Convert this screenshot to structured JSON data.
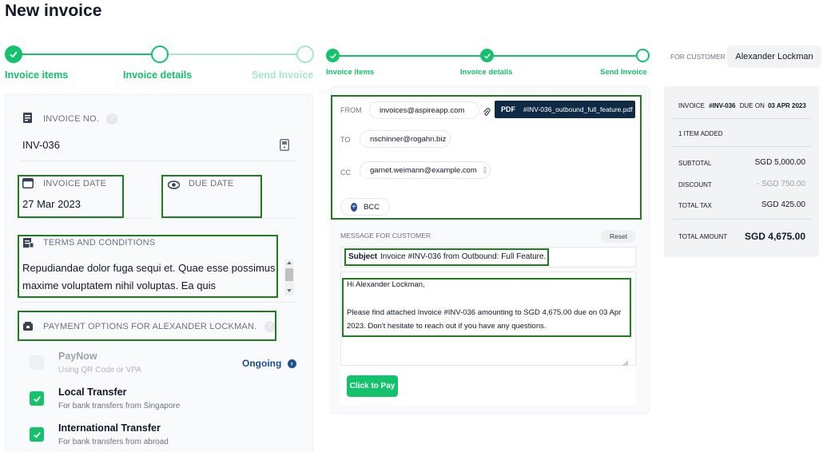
{
  "page": {
    "title": "New invoice"
  },
  "stepper_main": {
    "steps": [
      {
        "label": "Invoice items",
        "state": "done"
      },
      {
        "label": "Invoice details",
        "state": "current"
      },
      {
        "label": "Send Invoice",
        "state": "upcoming"
      }
    ]
  },
  "stepper_send": {
    "steps": [
      {
        "label": "Invoice items",
        "state": "done"
      },
      {
        "label": "Invoice details",
        "state": "done"
      },
      {
        "label": "Send Invoice",
        "state": "current"
      }
    ]
  },
  "details": {
    "invoice_no_label": "INVOICE NO.",
    "invoice_no_value": "INV-036",
    "invoice_date_label": "INVOICE DATE",
    "invoice_date_value": "27 Mar 2023",
    "due_date_label": "DUE DATE",
    "due_date_value": "",
    "terms_label": "TERMS AND CONDITIONS",
    "terms_value": "Repudiandae dolor fuga sequi et. Quae esse possimus maxime voluptatem nihil voluptas. Ea quis",
    "payment_options_label": "PAYMENT OPTIONS FOR ALEXANDER LOCKMAN.",
    "payment_methods": [
      {
        "title": "PayNow",
        "subtitle": "Using QR Code or VPA",
        "checked": false,
        "status": "Ongoing"
      },
      {
        "title": "Local Transfer",
        "subtitle": "For bank transfers from Singapore",
        "checked": true,
        "status": ""
      },
      {
        "title": "International Transfer",
        "subtitle": "For bank transfers from abroad",
        "checked": true,
        "status": ""
      }
    ]
  },
  "email": {
    "from_label": "FROM",
    "from_value": "invoices@aspireapp.com",
    "attachment_badge": "PDF",
    "attachment_name": "#INV-036_outbound_full_feature.pdf",
    "to_label": "TO",
    "to_value": "nschinner@rogahn.biz",
    "cc_label": "CC",
    "cc_value": "garnet.weimann@example.com",
    "bcc_label": "BCC",
    "message_label": "MESSAGE FOR CUSTOMER",
    "reset_label": "Reset",
    "subject_label": "Subject",
    "subject_value": "Invoice #INV-036 from Outbound: Full Feature.",
    "body_greeting": "Hi Alexander Lockman,",
    "body_text": "Please find attached Invoice #INV-036 amounting to SGD 4,675.00 due on 03 Apr 2023. Don't hesitate to reach out if you have any questions.",
    "pay_button_label": "Click to Pay"
  },
  "summary": {
    "for_customer_label": "FOR CUSTOMER",
    "customer_name": "Alexander Lockman",
    "invoice_prefix": "INVOICE",
    "invoice_number": "#INV-036",
    "due_prefix": "DUE ON",
    "due_date": "03 APR 2023",
    "items_added": "1 ITEM ADDED",
    "subtotal_label": "SUBTOTAL",
    "subtotal_value": "SGD 5,000.00",
    "discount_label": "DISCOUNT",
    "discount_value": "- SGD 750.00",
    "tax_label": "TOTAL TAX",
    "tax_value": "SGD 425.00",
    "total_label": "TOTAL AMOUNT",
    "total_value": "SGD 4,675.00"
  },
  "colors": {
    "brand_green": "#13c26b",
    "highlight_border": "#1e7d1e",
    "dark_navy": "#0f2a44",
    "link_blue": "#1d4f91"
  },
  "icons": [
    "check-icon",
    "invoice-doc-icon",
    "calculator-icon",
    "calendar-icon",
    "eye-icon",
    "terms-icon",
    "wallet-icon",
    "help-icon",
    "chevron-right-icon",
    "paperclip-icon",
    "plus-icon",
    "close-icon"
  ]
}
